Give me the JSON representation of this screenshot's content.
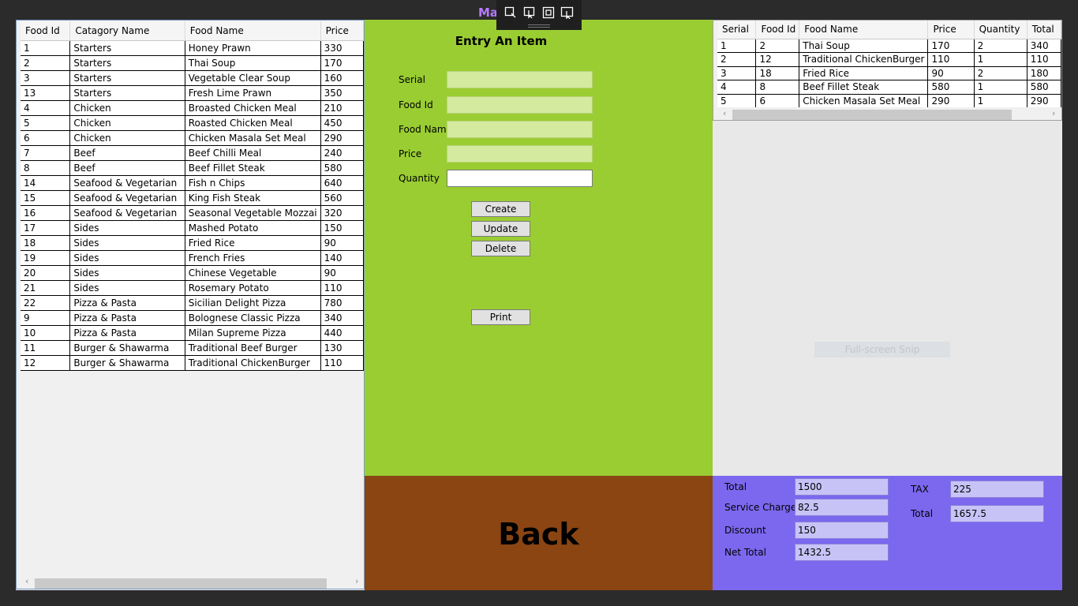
{
  "window": {
    "title": "Ma  ing"
  },
  "left_grid": {
    "columns": [
      "Food Id",
      "Catagory Name",
      "Food Name",
      "Price"
    ],
    "rows": [
      [
        "1",
        "Starters",
        "Honey Prawn",
        "330"
      ],
      [
        "2",
        "Starters",
        "Thai Soup",
        "170"
      ],
      [
        "3",
        "Starters",
        "Vegetable Clear Soup",
        "160"
      ],
      [
        "13",
        "Starters",
        "Fresh Lime Prawn",
        "350"
      ],
      [
        "4",
        "Chicken",
        "Broasted Chicken Meal",
        "210"
      ],
      [
        "5",
        "Chicken",
        "Roasted Chicken Meal",
        "450"
      ],
      [
        "6",
        "Chicken",
        "Chicken Masala Set Meal",
        "290"
      ],
      [
        "7",
        "Beef",
        "Beef Chilli Meal",
        "240"
      ],
      [
        "8",
        "Beef",
        "Beef Fillet Steak",
        "580"
      ],
      [
        "14",
        "Seafood & Vegetarian",
        "Fish n Chips",
        "640"
      ],
      [
        "15",
        "Seafood & Vegetarian",
        "King Fish Steak",
        "560"
      ],
      [
        "16",
        "Seafood & Vegetarian",
        "Seasonal Vegetable Mozzai",
        "320"
      ],
      [
        "17",
        "Sides",
        "Mashed Potato",
        "150"
      ],
      [
        "18",
        "Sides",
        "Fried Rice",
        "90"
      ],
      [
        "19",
        "Sides",
        "French Fries",
        "140"
      ],
      [
        "20",
        "Sides",
        "Chinese Vegetable",
        "90"
      ],
      [
        "21",
        "Sides",
        "Rosemary Potato",
        "110"
      ],
      [
        "22",
        "Pizza & Pasta",
        "Sicilian Delight Pizza",
        "780"
      ],
      [
        "9",
        "Pizza & Pasta",
        "Bolognese Classic Pizza",
        "340"
      ],
      [
        "10",
        "Pizza & Pasta",
        "Milan Supreme Pizza",
        "440"
      ],
      [
        "11",
        "Burger & Shawarma",
        "Traditional Beef Burger",
        "130"
      ],
      [
        "12",
        "Burger & Shawarma",
        "Traditional ChickenBurger",
        "110"
      ]
    ]
  },
  "entry": {
    "title": "Entry An Item",
    "fields": [
      {
        "label": "Serial",
        "value": ""
      },
      {
        "label": "Food Id",
        "value": ""
      },
      {
        "label": "Food Name",
        "value": ""
      },
      {
        "label": "Price",
        "value": ""
      },
      {
        "label": "Quantity",
        "value": ""
      }
    ],
    "buttons": {
      "create": "Create",
      "update": "Update",
      "delete": "Delete",
      "print": "Print"
    }
  },
  "back_label": "Back",
  "order_grid": {
    "columns": [
      "Serial",
      "Food Id",
      "Food Name",
      "Price",
      "Quantity",
      "Total"
    ],
    "rows": [
      [
        "1",
        "2",
        "Thai Soup",
        "170",
        "2",
        "340"
      ],
      [
        "2",
        "12",
        "Traditional ChickenBurger",
        "110",
        "1",
        "110"
      ],
      [
        "3",
        "18",
        "Fried Rice",
        "90",
        "2",
        "180"
      ],
      [
        "4",
        "8",
        "Beef Fillet Steak",
        "580",
        "1",
        "580"
      ],
      [
        "5",
        "6",
        "Chicken Masala Set Meal",
        "290",
        "1",
        "290"
      ]
    ]
  },
  "snip_hint": "Full-screen Snip",
  "totals": {
    "total_label": "Total",
    "total_value": "1500",
    "service_label": "Service Charge",
    "service_value": "82.5",
    "discount_label": "Discount",
    "discount_value": "150",
    "net_label": "Net Total",
    "net_value": "1432.5",
    "tax_label": "TAX",
    "tax_value": "225",
    "grand_label": "Total",
    "grand_value": "1657.5"
  },
  "colors": {
    "center_bg": "#9acd32",
    "back_bg": "#8b4513",
    "totals_bg": "#7b68ee",
    "title_color": "#b57bff"
  }
}
